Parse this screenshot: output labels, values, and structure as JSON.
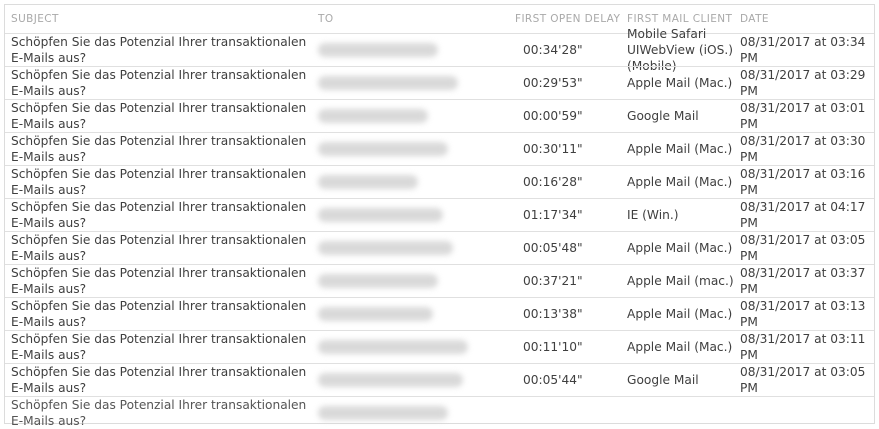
{
  "columns": {
    "subject": "SUBJECT",
    "to": "TO",
    "first_open_delay": "FIRST OPEN DELAY",
    "first_mail_client": "FIRST MAIL CLIENT",
    "date": "DATE"
  },
  "rows": [
    {
      "subject": "Schöpfen Sie das Potenzial Ihrer transaktionalen E-Mails aus?",
      "delay": "00:34'28\"",
      "client": "Mobile Safari UIWebView (iOS.) (Mobile)",
      "date": "08/31/2017 at 03:34 PM"
    },
    {
      "subject": "Schöpfen Sie das Potenzial Ihrer transaktionalen E-Mails aus?",
      "delay": "00:29'53\"",
      "client": "Apple Mail (Mac.)",
      "date": "08/31/2017 at 03:29 PM"
    },
    {
      "subject": "Schöpfen Sie das Potenzial Ihrer transaktionalen E-Mails aus?",
      "delay": "00:00'59\"",
      "client": "Google Mail",
      "date": "08/31/2017 at 03:01 PM"
    },
    {
      "subject": "Schöpfen Sie das Potenzial Ihrer transaktionalen E-Mails aus?",
      "delay": "00:30'11\"",
      "client": "Apple Mail (Mac.)",
      "date": "08/31/2017 at 03:30 PM"
    },
    {
      "subject": "Schöpfen Sie das Potenzial Ihrer transaktionalen E-Mails aus?",
      "delay": "00:16'28\"",
      "client": "Apple Mail (Mac.)",
      "date": "08/31/2017 at 03:16 PM"
    },
    {
      "subject": "Schöpfen Sie das Potenzial Ihrer transaktionalen E-Mails aus?",
      "delay": "01:17'34\"",
      "client": "IE (Win.)",
      "date": "08/31/2017 at 04:17 PM"
    },
    {
      "subject": "Schöpfen Sie das Potenzial Ihrer transaktionalen E-Mails aus?",
      "delay": "00:05'48\"",
      "client": "Apple Mail (Mac.)",
      "date": "08/31/2017 at 03:05 PM"
    },
    {
      "subject": "Schöpfen Sie das Potenzial Ihrer transaktionalen E-Mails aus?",
      "delay": "00:37'21\"",
      "client": "Apple Mail (mac.)",
      "date": "08/31/2017 at 03:37 PM"
    },
    {
      "subject": "Schöpfen Sie das Potenzial Ihrer transaktionalen E-Mails aus?",
      "delay": "00:13'38\"",
      "client": "Apple Mail (Mac.)",
      "date": "08/31/2017 at 03:13 PM"
    },
    {
      "subject": "Schöpfen Sie das Potenzial Ihrer transaktionalen E-Mails aus?",
      "delay": "00:11'10\"",
      "client": "Apple Mail (Mac.)",
      "date": "08/31/2017 at 03:11 PM"
    },
    {
      "subject": "Schöpfen Sie das Potenzial Ihrer transaktionalen E-Mails aus?",
      "delay": "00:05'44\"",
      "client": "Google Mail",
      "date": "08/31/2017 at 03:05 PM"
    },
    {
      "subject": "Schöpfen Sie das Potenzial Ihrer transaktionalen E-Mails aus?",
      "delay": "",
      "client": "",
      "date": ""
    }
  ]
}
